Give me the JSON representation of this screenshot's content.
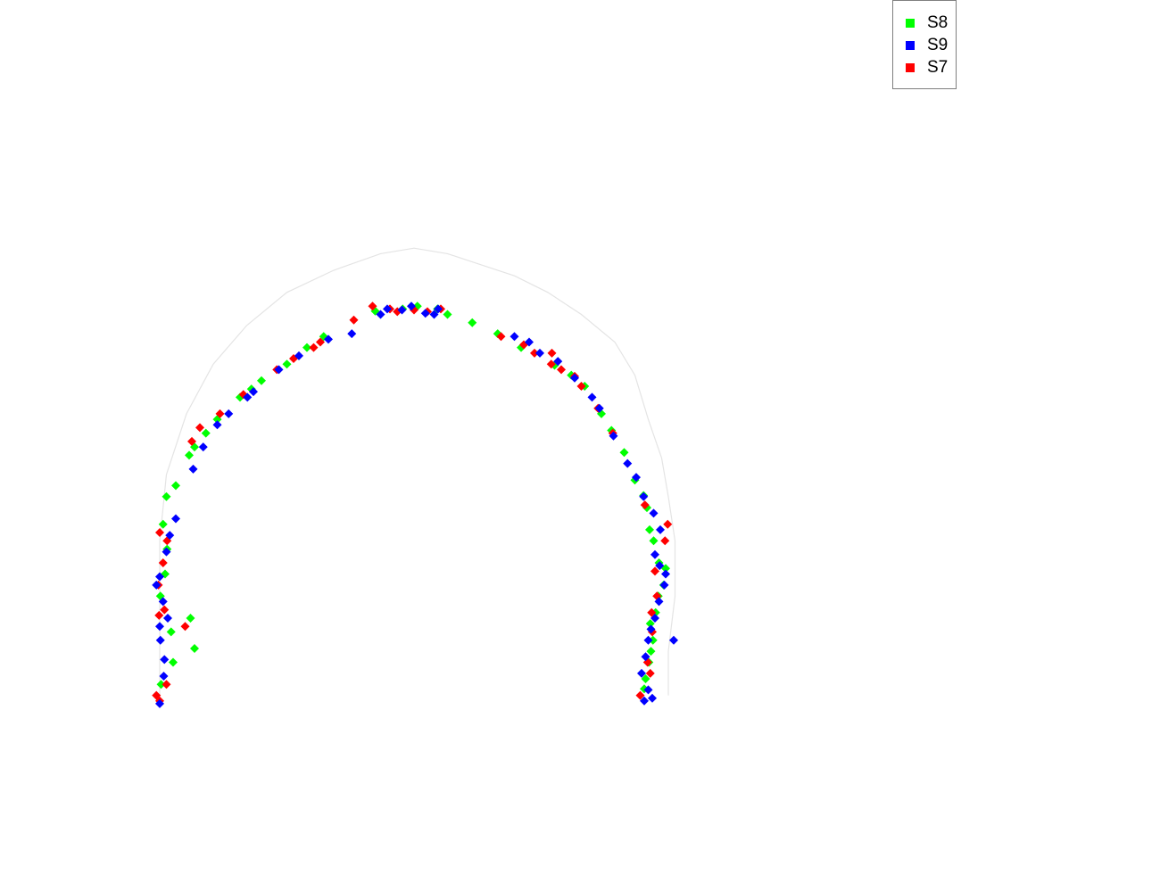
{
  "chart_data": {
    "type": "scatter",
    "title": "",
    "xlabel": "",
    "ylabel": "",
    "axes_visible": false,
    "grid": false,
    "legend_position": "top-right",
    "trajectory_line": true,
    "trajectory_color": "#e4e4e4",
    "marker": "diamond",
    "xlim": [
      0,
      100
    ],
    "ylim": [
      0,
      100
    ],
    "trajectory": [
      [
        2,
        2
      ],
      [
        2,
        10
      ],
      [
        2,
        20
      ],
      [
        2,
        30
      ],
      [
        3,
        42
      ],
      [
        6,
        53
      ],
      [
        10,
        62
      ],
      [
        15,
        69
      ],
      [
        21,
        75
      ],
      [
        28,
        79
      ],
      [
        35,
        82
      ],
      [
        40,
        83
      ],
      [
        45,
        82
      ],
      [
        50,
        80
      ],
      [
        55,
        78
      ],
      [
        60,
        75
      ],
      [
        65,
        71
      ],
      [
        70,
        66
      ],
      [
        73,
        60
      ],
      [
        75,
        52
      ],
      [
        77,
        45
      ],
      [
        78,
        38
      ],
      [
        79,
        30
      ],
      [
        79,
        20
      ],
      [
        78,
        10
      ],
      [
        78,
        2
      ]
    ],
    "series": [
      {
        "name": "S8",
        "color": "#00ff00",
        "points": [
          [
            2.2,
            4.0
          ],
          [
            4.0,
            8.0
          ],
          [
            6.6,
            16.0
          ],
          [
            7.2,
            10.5
          ],
          [
            3.7,
            13.5
          ],
          [
            2.1,
            20.0
          ],
          [
            2.8,
            24.0
          ],
          [
            3.1,
            28.5
          ],
          [
            2.5,
            33.0
          ],
          [
            3.0,
            38.0
          ],
          [
            4.4,
            40.0
          ],
          [
            6.4,
            45.5
          ],
          [
            7.2,
            47.0
          ],
          [
            8.9,
            49.5
          ],
          [
            10.6,
            52.0
          ],
          [
            14.0,
            56.0
          ],
          [
            15.7,
            57.5
          ],
          [
            17.2,
            59.0
          ],
          [
            21.0,
            62.0
          ],
          [
            24.0,
            65.0
          ],
          [
            26.5,
            67.0
          ],
          [
            34.2,
            71.6
          ],
          [
            38.3,
            72.0
          ],
          [
            40.5,
            72.5
          ],
          [
            43.5,
            72.0
          ],
          [
            45.0,
            71.0
          ],
          [
            48.7,
            69.5
          ],
          [
            52.5,
            67.5
          ],
          [
            56.0,
            65.0
          ],
          [
            61.0,
            61.8
          ],
          [
            63.5,
            60.0
          ],
          [
            65.5,
            58.0
          ],
          [
            68.0,
            53.0
          ],
          [
            69.5,
            50.0
          ],
          [
            71.4,
            46.0
          ],
          [
            73.0,
            41.0
          ],
          [
            74.3,
            38.2
          ],
          [
            74.8,
            36.0
          ],
          [
            75.2,
            32.0
          ],
          [
            75.8,
            30.0
          ],
          [
            76.6,
            26.0
          ],
          [
            77.6,
            25.0
          ],
          [
            77.3,
            22.0
          ],
          [
            76.5,
            20.0
          ],
          [
            76.1,
            17.0
          ],
          [
            75.3,
            15.0
          ],
          [
            75.7,
            12.0
          ],
          [
            75.1,
            8.0
          ],
          [
            74.6,
            5.0
          ],
          [
            74.4,
            3.2
          ],
          [
            75.4,
            10.0
          ]
        ]
      },
      {
        "name": "S9",
        "color": "#0000ff",
        "points": [
          [
            2.0,
            0.5
          ],
          [
            2.6,
            5.5
          ],
          [
            2.7,
            8.5
          ],
          [
            2.1,
            12.0
          ],
          [
            2.0,
            14.5
          ],
          [
            3.2,
            16.0
          ],
          [
            2.5,
            19.0
          ],
          [
            1.5,
            22.0
          ],
          [
            2.0,
            23.5
          ],
          [
            3.0,
            28.0
          ],
          [
            3.5,
            31.0
          ],
          [
            4.4,
            34.0
          ],
          [
            7.0,
            43.0
          ],
          [
            8.5,
            47.0
          ],
          [
            10.6,
            51.0
          ],
          [
            12.3,
            53.0
          ],
          [
            15.1,
            56.0
          ],
          [
            16.0,
            57.0
          ],
          [
            19.8,
            61.0
          ],
          [
            22.8,
            63.5
          ],
          [
            27.2,
            66.5
          ],
          [
            30.7,
            67.5
          ],
          [
            35.0,
            71.0
          ],
          [
            36.0,
            72.0
          ],
          [
            38.2,
            71.8
          ],
          [
            39.6,
            72.5
          ],
          [
            41.7,
            71.2
          ],
          [
            43.0,
            71.0
          ],
          [
            43.6,
            72.0
          ],
          [
            55.0,
            67.0
          ],
          [
            57.2,
            66.0
          ],
          [
            58.8,
            64.0
          ],
          [
            61.5,
            62.5
          ],
          [
            64.0,
            59.5
          ],
          [
            66.6,
            56.0
          ],
          [
            67.7,
            54.0
          ],
          [
            69.8,
            49.0
          ],
          [
            71.9,
            44.0
          ],
          [
            73.2,
            41.5
          ],
          [
            74.3,
            38.0
          ],
          [
            75.8,
            35.0
          ],
          [
            76.8,
            32.0
          ],
          [
            76.0,
            27.5
          ],
          [
            76.7,
            25.5
          ],
          [
            77.6,
            24.0
          ],
          [
            77.4,
            22.0
          ],
          [
            76.6,
            19.0
          ],
          [
            76.0,
            16.0
          ],
          [
            75.4,
            14.0
          ],
          [
            75.0,
            12.0
          ],
          [
            74.6,
            9.0
          ],
          [
            74.0,
            6.0
          ],
          [
            75.0,
            3.0
          ],
          [
            75.6,
            1.5
          ],
          [
            78.8,
            12.0
          ],
          [
            74.4,
            1.0
          ]
        ]
      },
      {
        "name": "S7",
        "color": "#ff0000",
        "points": [
          [
            1.5,
            2.0
          ],
          [
            2.0,
            1.0
          ],
          [
            3.0,
            4.0
          ],
          [
            5.8,
            14.5
          ],
          [
            1.9,
            16.5
          ],
          [
            2.7,
            17.5
          ],
          [
            1.8,
            22.0
          ],
          [
            2.5,
            26.0
          ],
          [
            3.1,
            30.0
          ],
          [
            2.0,
            31.5
          ],
          [
            6.8,
            48.0
          ],
          [
            8.0,
            50.5
          ],
          [
            11.0,
            53.0
          ],
          [
            14.5,
            56.5
          ],
          [
            19.5,
            61.0
          ],
          [
            22.0,
            63.0
          ],
          [
            25.0,
            65.0
          ],
          [
            26.0,
            66.0
          ],
          [
            31.0,
            70.0
          ],
          [
            33.8,
            72.5
          ],
          [
            36.4,
            72.0
          ],
          [
            37.5,
            71.5
          ],
          [
            40.0,
            71.8
          ],
          [
            42.0,
            71.5
          ],
          [
            44.0,
            72.0
          ],
          [
            53.0,
            67.0
          ],
          [
            56.4,
            65.5
          ],
          [
            58.0,
            64.0
          ],
          [
            60.5,
            62.0
          ],
          [
            62.0,
            61.0
          ],
          [
            64.0,
            59.8
          ],
          [
            65.0,
            58.0
          ],
          [
            67.5,
            54.0
          ],
          [
            69.7,
            49.5
          ],
          [
            74.5,
            36.5
          ],
          [
            77.9,
            33.0
          ],
          [
            77.5,
            30.0
          ],
          [
            76.0,
            24.5
          ],
          [
            76.3,
            20.0
          ],
          [
            75.5,
            17.0
          ],
          [
            75.6,
            13.5
          ],
          [
            74.9,
            8.0
          ],
          [
            73.8,
            2.0
          ],
          [
            75.3,
            6.0
          ],
          [
            60.6,
            64.0
          ]
        ]
      }
    ]
  }
}
